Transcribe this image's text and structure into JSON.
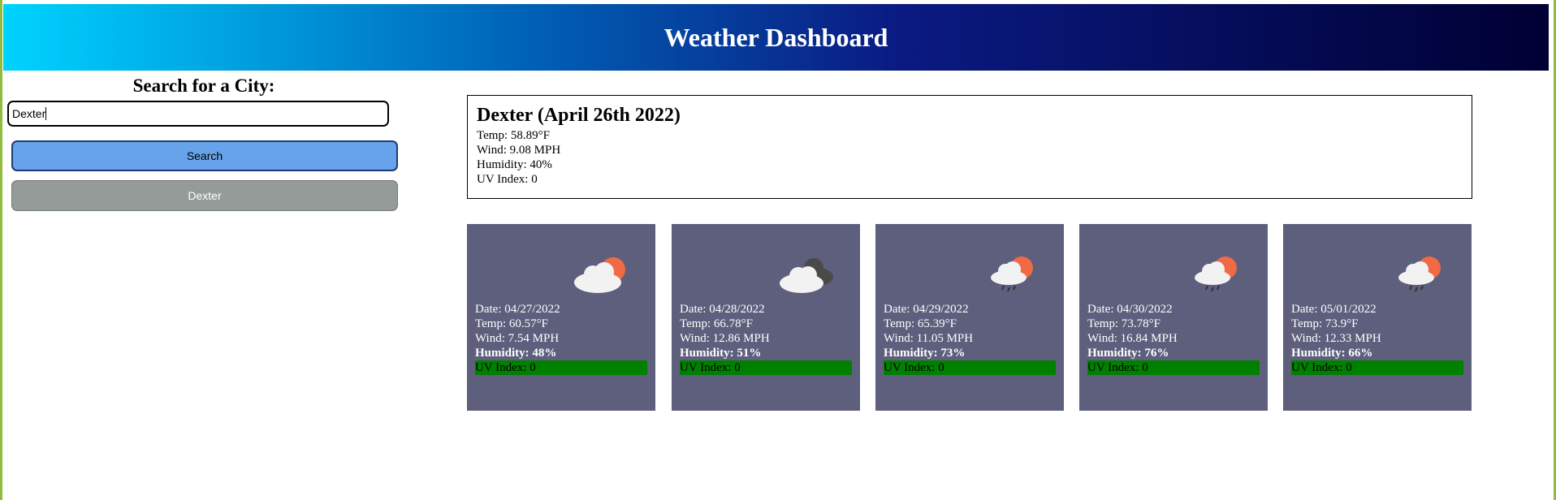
{
  "header": {
    "title": "Weather Dashboard"
  },
  "sidebar": {
    "heading": "Search for a City:",
    "search_value": "Dexter",
    "search_button": "Search",
    "history": [
      "Dexter"
    ]
  },
  "current": {
    "title": "Dexter (April 26th 2022)",
    "temp": "Temp: 58.89°F",
    "wind": "Wind: 9.08 MPH",
    "humidity": "Humidity: 40%",
    "uv": "UV Index: 0"
  },
  "forecast": [
    {
      "icon": "partly-cloudy-icon",
      "date": "Date: 04/27/2022",
      "temp": "Temp: 60.57°F",
      "wind": "Wind: 7.54 MPH",
      "humidity": "Humidity: 48%",
      "uv": "UV Index: 0"
    },
    {
      "icon": "cloudy-icon",
      "date": "Date: 04/28/2022",
      "temp": "Temp: 66.78°F",
      "wind": "Wind: 12.86 MPH",
      "humidity": "Humidity: 51%",
      "uv": "UV Index: 0"
    },
    {
      "icon": "rain-sun-icon",
      "date": "Date: 04/29/2022",
      "temp": "Temp: 65.39°F",
      "wind": "Wind: 11.05 MPH",
      "humidity": "Humidity: 73%",
      "uv": "UV Index: 0"
    },
    {
      "icon": "rain-sun-icon",
      "date": "Date: 04/30/2022",
      "temp": "Temp: 73.78°F",
      "wind": "Wind: 16.84 MPH",
      "humidity": "Humidity: 76%",
      "uv": "UV Index: 0"
    },
    {
      "icon": "rain-sun-icon",
      "date": "Date: 05/01/2022",
      "temp": "Temp: 73.9°F",
      "wind": "Wind: 12.33 MPH",
      "humidity": "Humidity: 66%",
      "uv": "UV Index: 0"
    }
  ],
  "colors": {
    "uv_low": "#008000",
    "card_bg": "#5d5f7d",
    "search_button": "#66a3ea",
    "history_button": "#959b98"
  }
}
